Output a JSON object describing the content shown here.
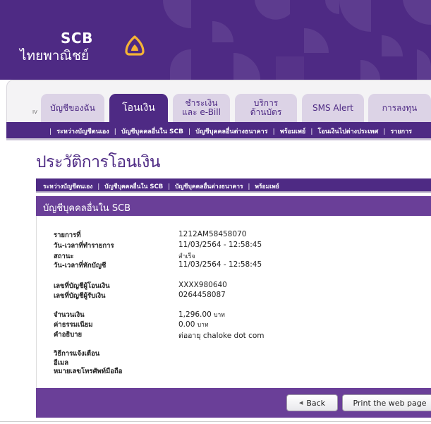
{
  "header": {
    "brand_short": "SCB",
    "brand_thai": "ไทยพาณิชย์"
  },
  "tabs": {
    "marker": "IV",
    "items": [
      {
        "line1": "บัญชีของฉัน",
        "line2": ""
      },
      {
        "line1": "โอนเงิน",
        "line2": ""
      },
      {
        "line1": "ชำระเงิน",
        "line2": "และ e-Bill"
      },
      {
        "line1": "บริการ",
        "line2": "ด้านบัตร"
      },
      {
        "line1": "SMS Alert",
        "line2": ""
      },
      {
        "line1": "การลงทุน",
        "line2": ""
      }
    ],
    "active_index": 1
  },
  "submenu": {
    "items": [
      "ระหว่างบัญชีตนเอง",
      "บัญชีบุคคลอื่นใน SCB",
      "บัญชีบุคคลอื่นต่างธนาคาร",
      "พร้อมเพย์",
      "โอนเงินไปต่างประเทศ",
      "รายการ"
    ]
  },
  "page": {
    "title": "ประวัติการโอนเงิน"
  },
  "inner_nav": {
    "items": [
      "ระหว่างบัญชีตนเอง",
      "บัญชีบุคคลอื่นใน SCB",
      "บัญชีบุคคลอื่นต่างธนาคาร",
      "พร้อมเพย์"
    ]
  },
  "section": {
    "title": "บัญชีบุคคลอื่นใน SCB"
  },
  "details": {
    "ref_label": "รายการที่",
    "ref_value": "1212AM58458070",
    "txn_time_label": "วัน-เวลาที่ทำรายการ",
    "txn_time_value": "11/03/2564 - 12:58:45",
    "status_label": "สถานะ",
    "status_value": "สำเร็จ",
    "debit_time_label": "วัน-เวลาที่หักบัญชี",
    "debit_time_value": "11/03/2564 - 12:58:45",
    "from_acct_label": "เลขที่บัญชีผู้โอนเงิน",
    "from_acct_value": "XXXX980640",
    "to_acct_label": "เลขที่บัญชีผู้รับเงิน",
    "to_acct_value": "0264458087",
    "amount_label": "จำนวนเงิน",
    "amount_value": "1,296.00",
    "amount_unit": "บาท",
    "fee_label": "ค่าธรรมเนียม",
    "fee_value": "0.00",
    "fee_unit": "บาท",
    "memo_label": "คำอธิบาย",
    "memo_value": "ต่ออายุ chaloke dot com",
    "notify_label": "วิธีการแจ้งเตือน",
    "email_label": "อีเมล",
    "mobile_label": "หมายเลขโทรศัพท์มือถือ"
  },
  "footer": {
    "back_label": "Back",
    "print_label": "Print the web page"
  },
  "colors": {
    "brand_purple": "#4e2a84",
    "section_purple": "#6a3f98",
    "logo_gold": "#f5b335"
  }
}
